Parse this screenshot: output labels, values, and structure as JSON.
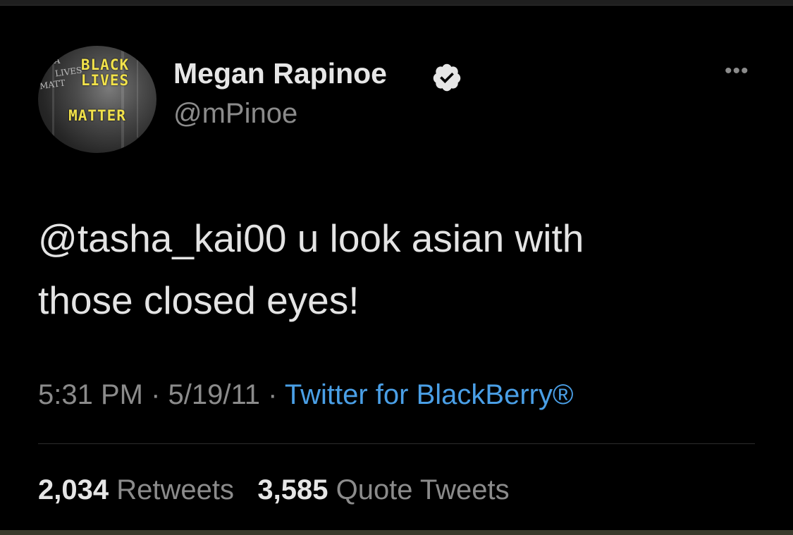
{
  "user": {
    "display_name": "Megan Rapinoe",
    "handle": "@mPinoe",
    "verified": true,
    "avatar_sign": [
      "BLACK",
      "LIVES",
      "MATTER"
    ],
    "avatar_bg_text": [
      "BLA",
      "LIVES",
      "MATT"
    ]
  },
  "tweet": {
    "text_line1": "@tasha_kai00 u look asian with",
    "text_line2": "those closed eyes!",
    "time": "5:31 PM",
    "date": "5/19/11",
    "separator": "·",
    "source": "Twitter for BlackBerry®"
  },
  "stats": {
    "retweets_count": "2,034",
    "retweets_label": "Retweets",
    "quotes_count": "3,585",
    "quotes_label": "Quote Tweets"
  },
  "icons": {
    "more": "more-options-icon",
    "verified": "verified-badge-icon"
  },
  "colors": {
    "background": "#000000",
    "link": "#4a9fe6",
    "muted": "#8b8b8b",
    "sign_yellow": "#f2e24b"
  }
}
